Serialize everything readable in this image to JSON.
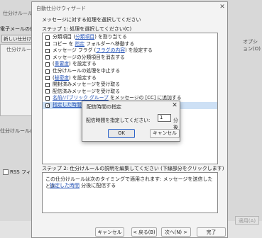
{
  "background": {
    "title": "仕分けルールと通知",
    "subtitle": "電子メールの仕分け",
    "new_rule_button": "新しい仕分け",
    "column_header": "仕分けルール",
    "rule_description_label": "仕分けルールの説",
    "rss_checkbox_label": "RSS フィードの",
    "options_label": "オプション(O)",
    "apply_button": "適用(A)"
  },
  "wizard": {
    "title": "自動仕分けウィザード",
    "prompt": "メッセージに対する処理を選択してください",
    "step1": "ステップ 1: 処理を選択してください(C)",
    "conditions": [
      {
        "checked": false,
        "pre": "",
        "link": "分類項目",
        "post": "分類項目 (分類項目) を割り当てる",
        "text": "分類項目 (分類項目) を割り当てる"
      },
      {
        "checked": false,
        "text": "コピー を 指定 フォルダーへ移動する"
      },
      {
        "checked": false,
        "text": "メッセージ フラグ (フラグの内容) を設定する"
      },
      {
        "checked": false,
        "text": "メッセージの分類項目を消去する"
      },
      {
        "checked": false,
        "text": "(重要度) を設定する"
      },
      {
        "checked": false,
        "text": "仕分けルールの処理を中止する"
      },
      {
        "checked": false,
        "text": "(秘密度) を設定する"
      },
      {
        "checked": false,
        "text": "開封済みメッセージを受け取る"
      },
      {
        "checked": false,
        "text": "配信済みメッセージを受け取る"
      },
      {
        "checked": false,
        "text": "名前/パブリック グループ をメッセージの [CC] に追加する"
      },
      {
        "checked": true,
        "text": "指定した時間 分後に配信する",
        "selected": true
      }
    ],
    "step2": "ステップ 2: 仕分けルールの説明を編集してください (下線部分をクリックします)(D)",
    "description_line1": "この仕分けルールは次のタイミングで適用されます: メッセージを送信したとき",
    "description_link": "指定した時間",
    "description_suffix": " 分後に配信する",
    "buttons": {
      "cancel": "キャンセル",
      "back": "< 戻る(B)",
      "next": "次へ(N) >",
      "finish": "完了"
    }
  },
  "modal": {
    "title": "配信時間の指定",
    "label": "配信時間を指定してください:",
    "value": "1",
    "unit": "分後",
    "ok": "OK",
    "cancel": "キャンセル"
  }
}
